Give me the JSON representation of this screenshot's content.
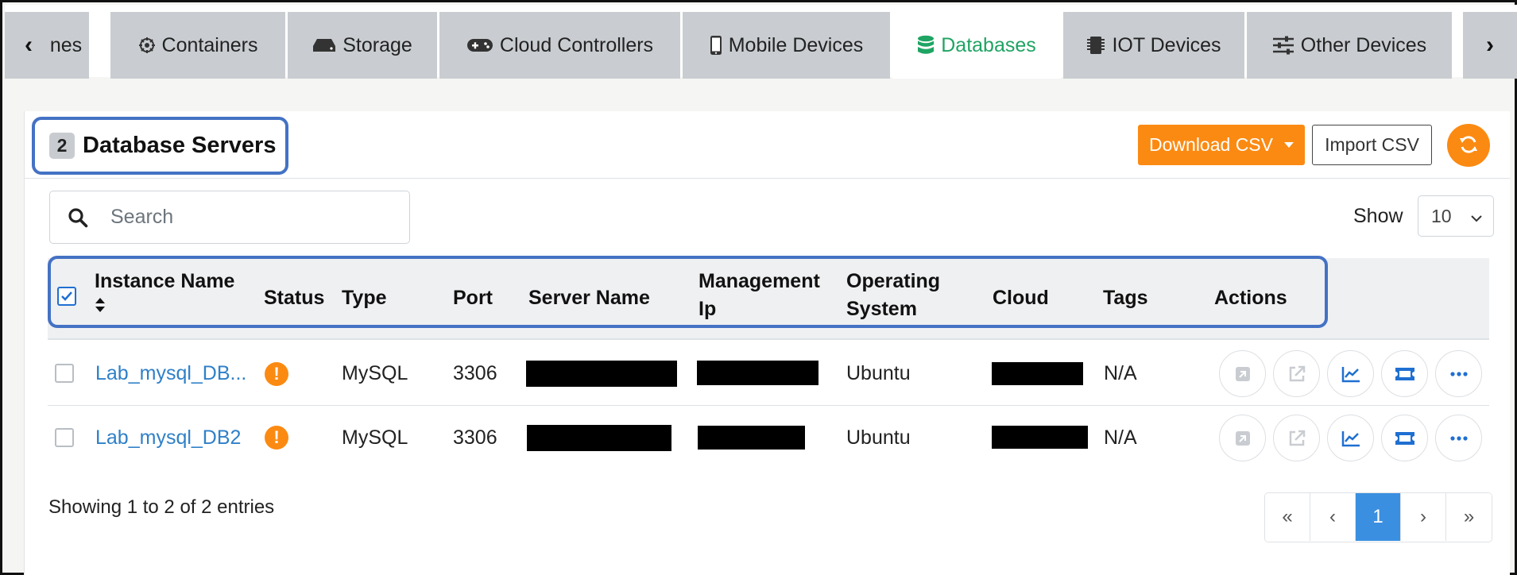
{
  "tabs": {
    "prev_arrow": "‹",
    "next_arrow": "›",
    "items": [
      {
        "label": "nes",
        "icon": "none"
      },
      {
        "label": "Containers",
        "icon": "helm-icon"
      },
      {
        "label": "Storage",
        "icon": "hdd-icon"
      },
      {
        "label": "Cloud Controllers",
        "icon": "gamepad-icon"
      },
      {
        "label": "Mobile Devices",
        "icon": "mobile-icon"
      },
      {
        "label": "Databases",
        "icon": "database-icon",
        "active": true
      },
      {
        "label": "IOT Devices",
        "icon": "chip-icon"
      },
      {
        "label": "Other Devices",
        "icon": "sliders-icon"
      }
    ]
  },
  "panel": {
    "count": "2",
    "title": "Database Servers",
    "download_label": "Download CSV",
    "import_label": "Import CSV"
  },
  "search": {
    "placeholder": "Search"
  },
  "page_size": {
    "label": "Show",
    "value": "10"
  },
  "table": {
    "headers": {
      "instance_name": "Instance Name",
      "status": "Status",
      "type": "Type",
      "port": "Port",
      "server_name": "Server Name",
      "management_ip_1": "Management",
      "management_ip_2": "Ip",
      "os_1": "Operating",
      "os_2": "System",
      "cloud": "Cloud",
      "tags": "Tags",
      "actions": "Actions"
    },
    "rows": [
      {
        "instance_name": "Lab_mysql_DB...",
        "status": "!",
        "type": "MySQL",
        "port": "3306",
        "os": "Ubuntu",
        "tags": "N/A"
      },
      {
        "instance_name": "Lab_mysql_DB2",
        "status": "!",
        "type": "MySQL",
        "port": "3306",
        "os": "Ubuntu",
        "tags": "N/A"
      }
    ]
  },
  "footer": {
    "entries_text": "Showing 1 to 2 of 2 entries"
  },
  "pagination": {
    "first": "«",
    "prev": "‹",
    "current": "1",
    "next": "›",
    "last": "»"
  },
  "colors": {
    "accent_orange": "#fb8a12",
    "active_tab_green": "#1fa463",
    "link_blue": "#2f80c8",
    "highlight_blue": "#4472c4"
  }
}
